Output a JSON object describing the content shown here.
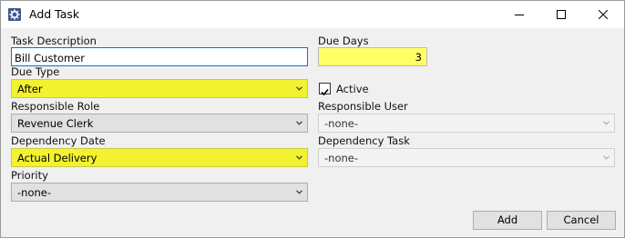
{
  "window": {
    "title": "Add Task",
    "icon": "gear-app-icon",
    "controls": [
      "minimize-icon",
      "maximize-icon",
      "close-icon"
    ]
  },
  "form": {
    "task_description": {
      "label": "Task Description",
      "value": "Bill Customer"
    },
    "due_days": {
      "label": "Due Days",
      "value": "3"
    },
    "due_type": {
      "label": "Due Type",
      "value": "After"
    },
    "active": {
      "label": "Active",
      "checked": true
    },
    "responsible_role": {
      "label": "Responsible Role",
      "value": "Revenue Clerk"
    },
    "responsible_user": {
      "label": "Responsible User",
      "value": "-none-"
    },
    "dependency_date": {
      "label": "Dependency Date",
      "value": "Actual Delivery"
    },
    "dependency_task": {
      "label": "Dependency Task",
      "value": "-none-"
    },
    "priority": {
      "label": "Priority",
      "value": "-none-"
    }
  },
  "buttons": {
    "add": "Add",
    "cancel": "Cancel"
  },
  "colors": {
    "highlight": "#f2f230",
    "focus_border": "#0078d7"
  }
}
